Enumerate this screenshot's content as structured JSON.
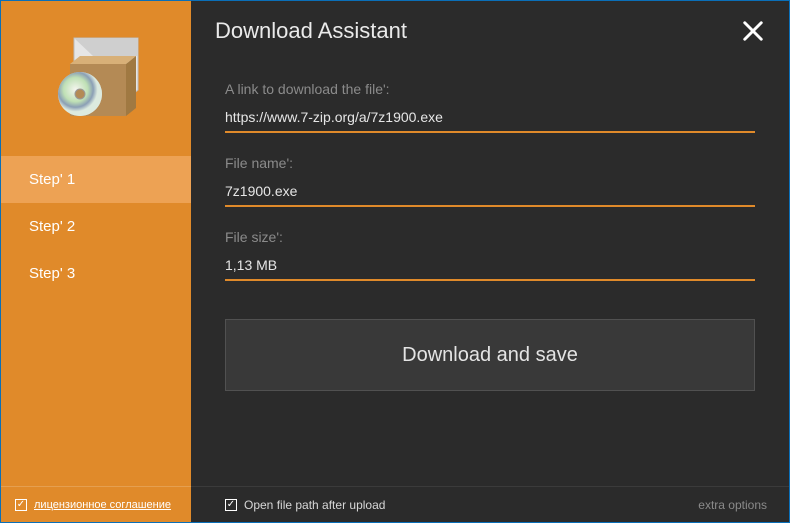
{
  "title": "Download Assistant",
  "sidebar": {
    "steps": [
      {
        "label": "Step' 1",
        "active": true
      },
      {
        "label": "Step' 2",
        "active": false
      },
      {
        "label": "Step' 3",
        "active": false
      }
    ],
    "license_checked": true,
    "license_label": "лицензионное соглашение"
  },
  "form": {
    "link_label": "A link to download the file':",
    "link_value": "https://www.7-zip.org/a/7z1900.exe",
    "filename_label": "File name':",
    "filename_value": "7z1900.exe",
    "filesize_label": "File size':",
    "filesize_value": "1,13 MB",
    "download_button": "Download and save"
  },
  "footer": {
    "open_path_checked": true,
    "open_path_label": "Open file path after upload",
    "extra_options": "extra options"
  },
  "colors": {
    "accent": "#e08a2a",
    "window_border": "#0a6fb8",
    "bg_dark": "#2b2b2b"
  }
}
